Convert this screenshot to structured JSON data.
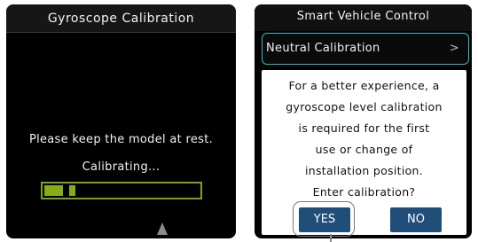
{
  "left_screen": {
    "title": "Gyroscope Calibration",
    "message": "Please keep the model at rest.",
    "status": "Calibrating...",
    "progress_fraction": 0.2
  },
  "right_screen": {
    "title": "Smart Vehicle Control",
    "menu_item": {
      "label": "Neutral Calibration",
      "chevron": ">"
    },
    "dialog": {
      "lines": [
        "For a better experience, a",
        "gyroscope level calibration",
        "is required for the first",
        "use or change of",
        "installation position.",
        "Enter calibration?"
      ],
      "yes_label": "YES",
      "no_label": "NO"
    }
  },
  "colors": {
    "progress": "#86ad16",
    "accent_border": "#2dbfc7",
    "button": "#1f4e79"
  }
}
